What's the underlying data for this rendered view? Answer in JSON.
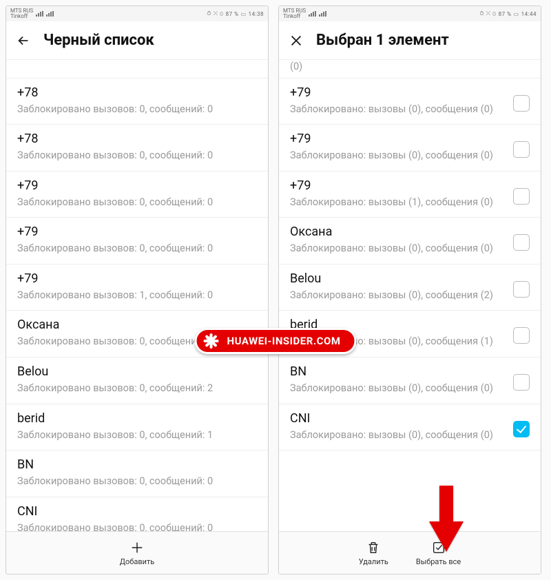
{
  "statusbar": {
    "carrier1": "MTS RUS",
    "carrier2": "Tinkoff",
    "battery": "87 %",
    "time_left": "14:38",
    "time_right": "14:44",
    "icons": "⏱ ⤬ ⊙"
  },
  "left": {
    "title": "Черный список",
    "truncated_top": "",
    "rows": [
      {
        "title": "+78",
        "sub": "Заблокировано вызовов: 0, сообщений: 0"
      },
      {
        "title": "+78",
        "sub": "Заблокировано вызовов: 0, сообщений: 0"
      },
      {
        "title": "+79",
        "sub": "Заблокировано вызовов: 0, сообщений: 0"
      },
      {
        "title": "+79",
        "sub": "Заблокировано вызовов: 0, сообщений: 0"
      },
      {
        "title": "+79",
        "sub": "Заблокировано вызовов: 1, сообщений: 0"
      },
      {
        "title": "Оксана",
        "sub": "Заблокировано вызовов: 0, сообщений: 0"
      },
      {
        "title": "Belou",
        "sub": "Заблокировано вызовов: 0, сообщений: 2"
      },
      {
        "title": "berid",
        "sub": "Заблокировано вызовов: 0, сообщений: 1"
      },
      {
        "title": "BN",
        "sub": "Заблокировано вызовов: 0, сообщений: 0"
      },
      {
        "title": "CNI",
        "sub": "Заблокировано вызовов: 0, сообщений: 0"
      }
    ],
    "bottom": {
      "add": "Добавить"
    }
  },
  "right": {
    "title": "Выбран 1 элемент",
    "top_tail": "(0)",
    "rows": [
      {
        "title": "+79",
        "sub": "Заблокировано: вызовы (0), сообщения (0)",
        "checked": false
      },
      {
        "title": "+79",
        "sub": "Заблокировано: вызовы (0), сообщения (0)",
        "checked": false
      },
      {
        "title": "+79",
        "sub": "Заблокировано: вызовы (1), сообщения (0)",
        "checked": false
      },
      {
        "title": "Оксана",
        "sub": "Заблокировано: вызовы (0), сообщения (0)",
        "checked": false
      },
      {
        "title": "Belou",
        "sub": "Заблокировано: вызовы (0), сообщения (2)",
        "checked": false
      },
      {
        "title": "berid",
        "sub": "Заблокировано: вызовы (0), сообщения (1)",
        "checked": false
      },
      {
        "title": "BN",
        "sub": "Заблокировано: вызовы (0), сообщения (0)",
        "checked": false
      },
      {
        "title": "CNI",
        "sub": "Заблокировано: вызовы (0), сообщения (0)",
        "checked": true
      }
    ],
    "bottom": {
      "delete": "Удалить",
      "select_all": "Выбрать все"
    }
  },
  "watermark": "HUAWEI-INSIDER.COM"
}
